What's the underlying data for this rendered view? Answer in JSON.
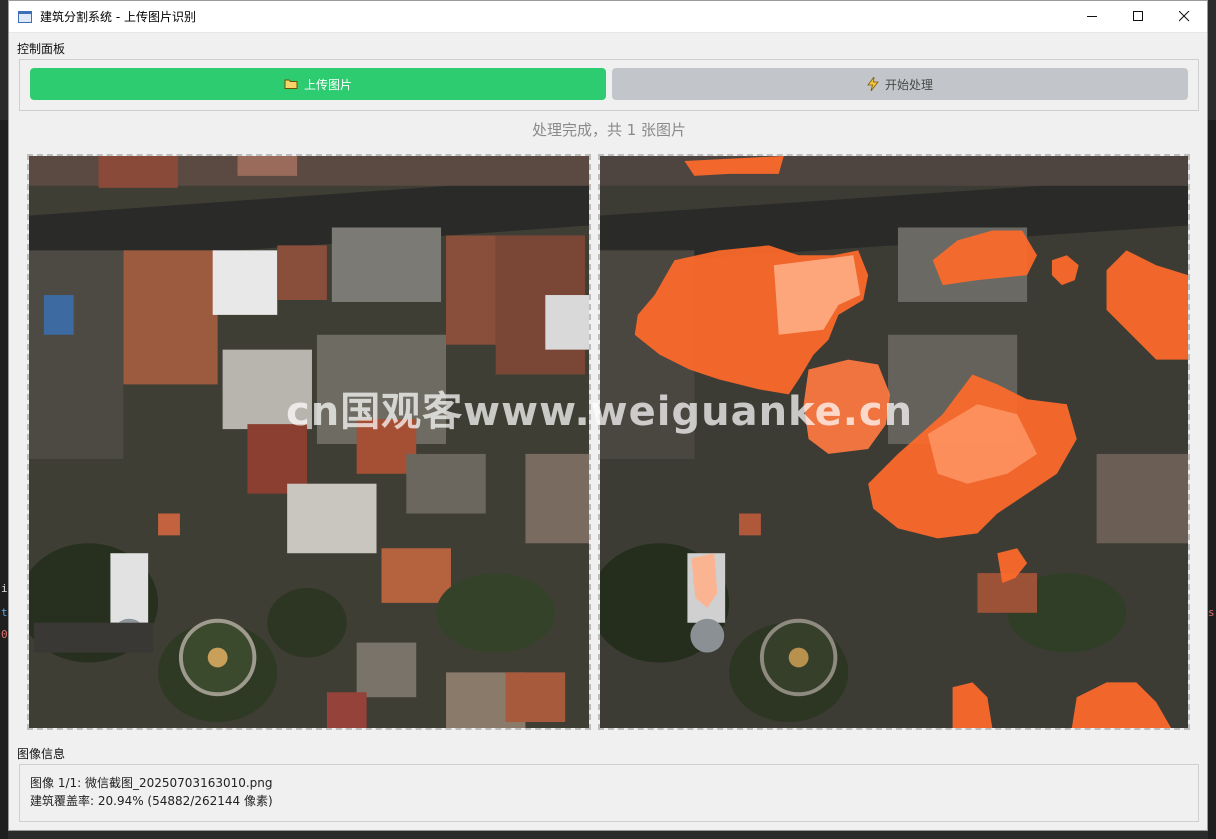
{
  "window": {
    "title": "建筑分割系统 - 上传图片识别"
  },
  "bleed": {
    "left_chars": [
      "i",
      "t",
      "0"
    ],
    "right_char": "s"
  },
  "control_panel": {
    "label": "控制面板",
    "upload_button": "上传图片",
    "process_button": "开始处理",
    "upload_color": "#2ecc71",
    "process_color": "#c2c5c9"
  },
  "status_text": "处理完成，共 1 张图片",
  "images": {
    "original_icon": "aerial-photo",
    "result_icon": "segmentation-overlay",
    "overlay_color": "#ff6a2a"
  },
  "watermark": "cn国观客www.weiguanke.cn",
  "image_info": {
    "label": "图像信息",
    "line1": "图像 1/1: 微信截图_20250703163010.png",
    "line2": "建筑覆盖率: 20.94% (54882/262144 像素)"
  }
}
